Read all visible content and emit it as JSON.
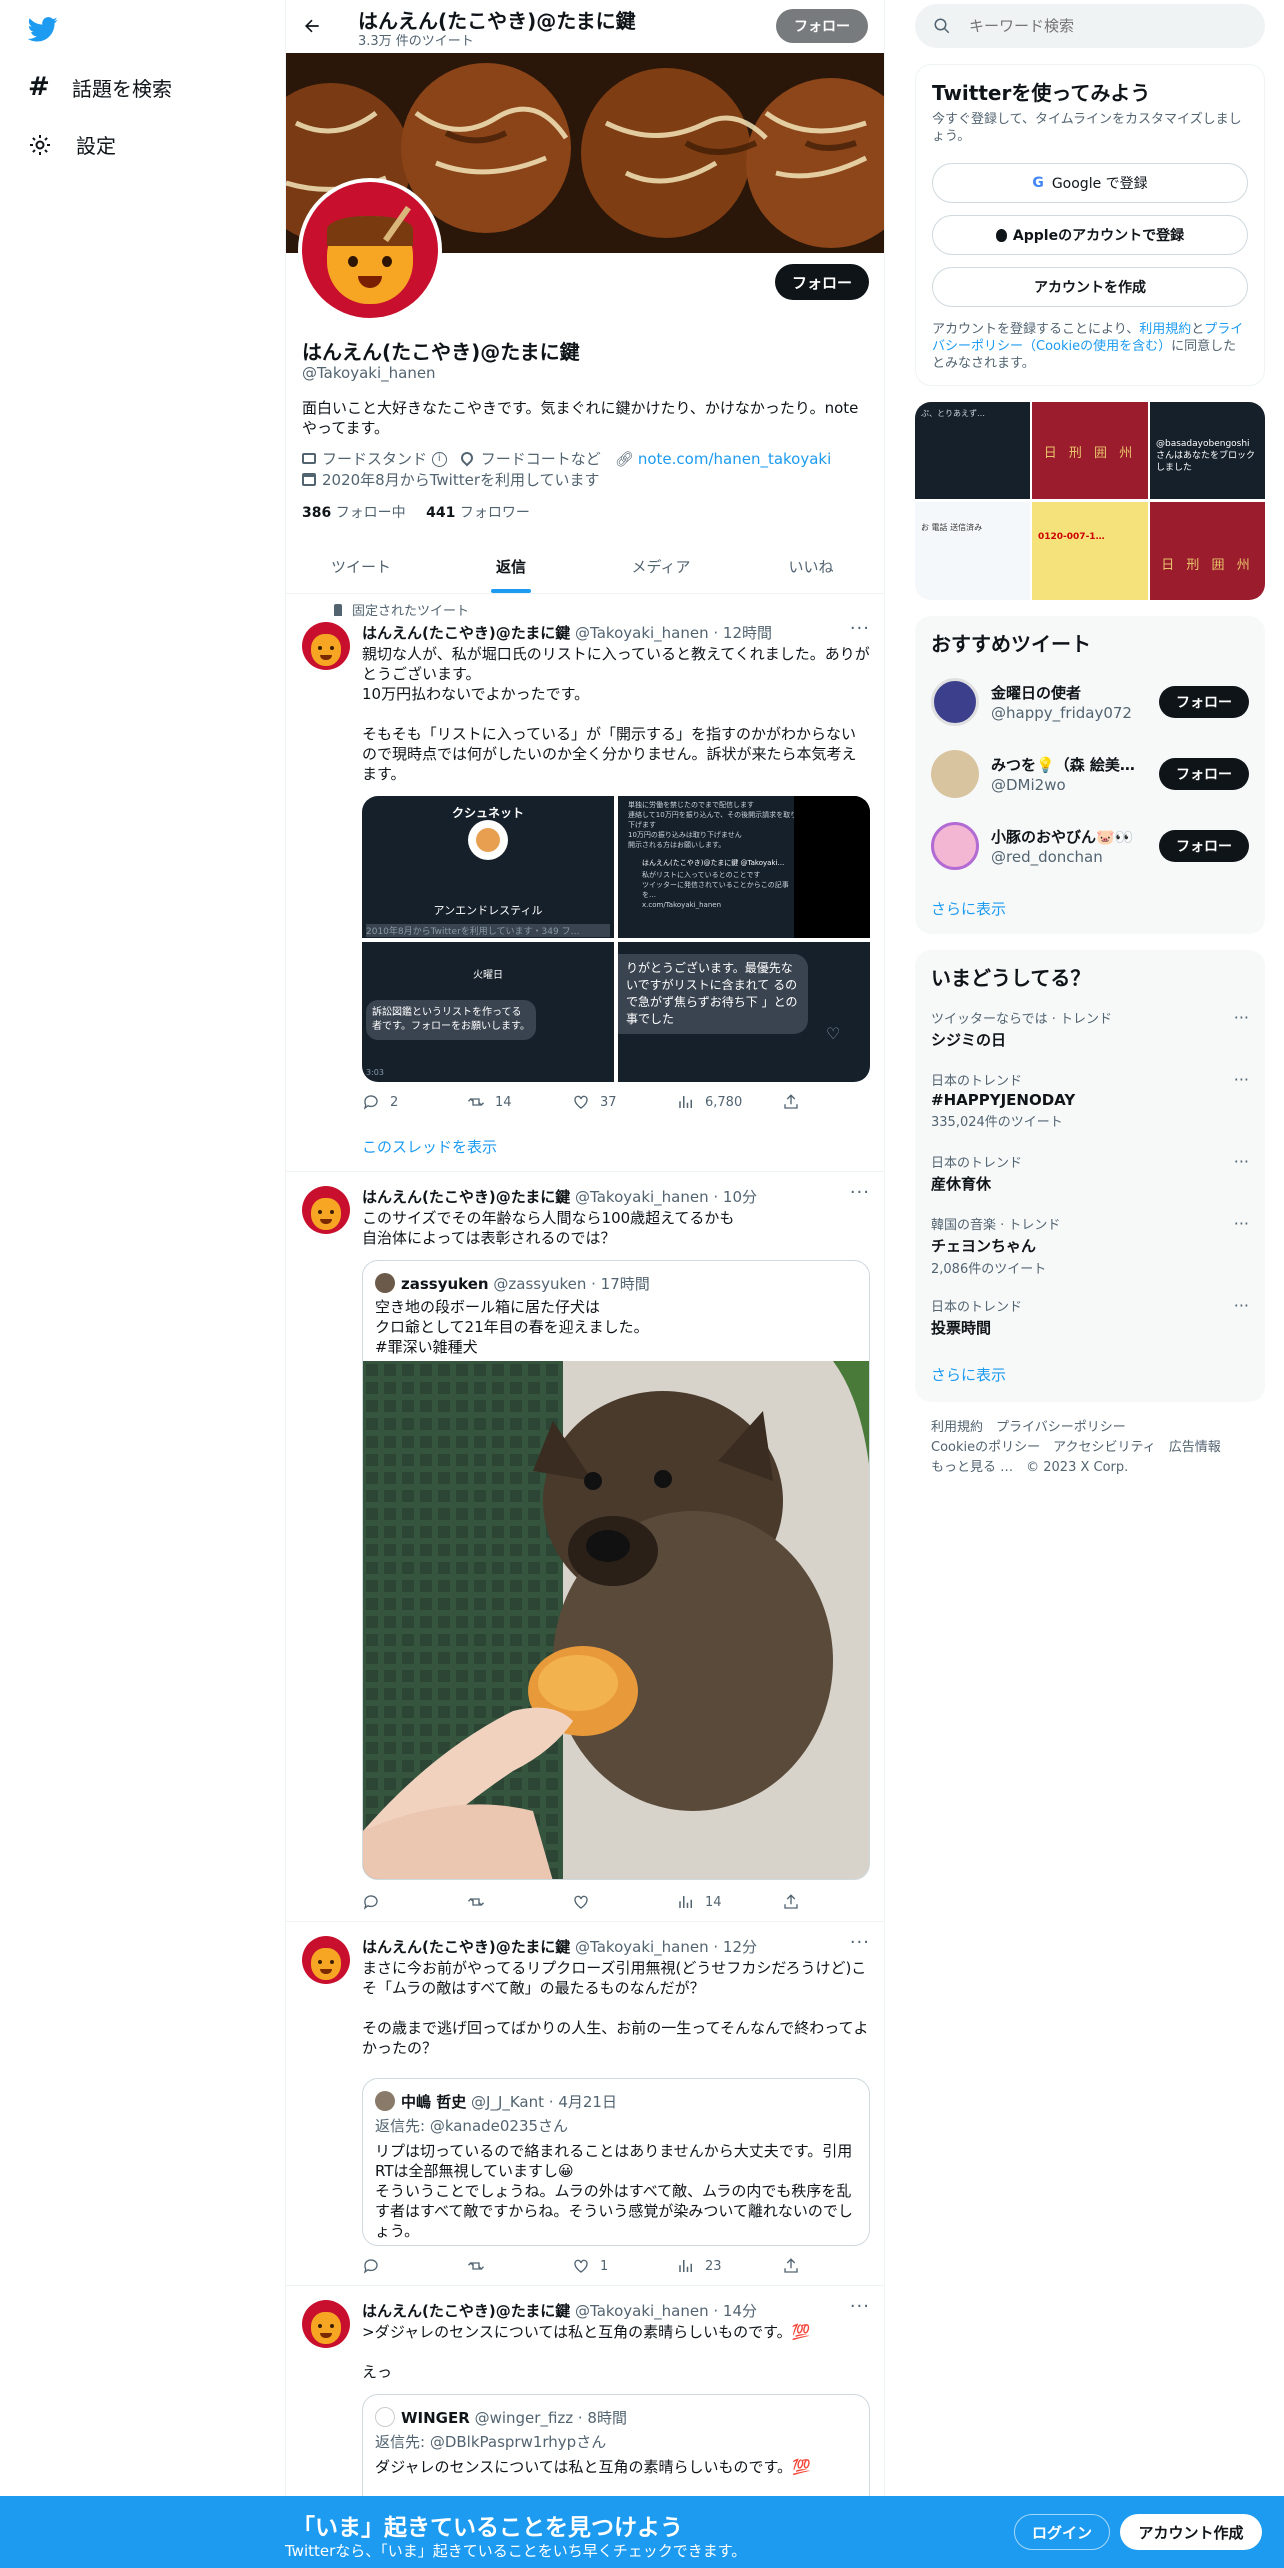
{
  "nav": {
    "explore": "話題を検索",
    "settings": "設定"
  },
  "header": {
    "title": "はんえん(たこやき)@たまに鍵",
    "subtitle": "3.3万 件のツイート",
    "follow": "フォロー"
  },
  "profile": {
    "name": "はんえん(たこやき)@たまに鍵",
    "handle": "@Takoyaki_hanen",
    "follow": "フォロー",
    "bio": "面白いこと大好きなたこやきです。気まぐれに鍵かけたり、かけなかったり。noteやってます。",
    "category": "フードスタンド",
    "location": "フードコートなど",
    "link": "note.com/hanen_takoyaki",
    "joined": "2020年8月からTwitterを利用しています",
    "following_count": "386",
    "following_label": "フォロー中",
    "followers_count": "441",
    "followers_label": "フォロワー"
  },
  "tabs": [
    "ツイート",
    "返信",
    "メディア",
    "いいね"
  ],
  "tweets": [
    {
      "pinned": "固定されたツイート",
      "name": "はんえん(たこやき)@たまに鍵",
      "meta": "@Takoyaki_hanen · 12時間",
      "text": "親切な人が、私が堀口氏のリストに入っていると教えてくれました。ありがとうございます。\n10万円払わないでよかったです。\n\nそもそも「リストに入っている」が「開示する」を指すのかがわからないので現時点では何がしたいのか全く分かりません。訴状が来たら本気考えます。",
      "img1_title": "クシュネット",
      "img1_name": "アンエンドレスティル",
      "img1_joined": "2010年8月からTwitterを利用しています・349 フ…",
      "img2_lines": "単独に労働を禁じたのでまで配信します\n連絡して10万円を振り込んで、その後開示請求を取り下げます\n10万円の振り込みは取り下げません\n開示される方はお願いします。",
      "img2_user": "はんえん(たこやき)@たまに鍵 @Takoyaki…",
      "img2_text": "私がリストに入っているとのことです\nツイッターに発信されていることからこの記事を…\nx.com/Takoyaki_hanen",
      "img3_day": "火曜日",
      "img3_bubble": "訴訟図鑑というリストを作ってる者です。フォローをお願いします。",
      "img3_time": "3:03",
      "img4_bubble": "りがとうございます。最優先ないですがリストに含まれて るので急がず焦らずお待ち下 」との事でした",
      "reply": "2",
      "retweet": "14",
      "like": "37",
      "views": "6,780",
      "thread": "このスレッドを表示"
    },
    {
      "name": "はんえん(たこやき)@たまに鍵",
      "meta": "@Takoyaki_hanen · 10分",
      "text": "このサイズでその年齢なら人間なら100歳超えてるかも\n自治体によっては表彰されるのでは？",
      "q_name": "zassyuken",
      "q_meta": "@zassyuken · 17時間",
      "q_text": "空き地の段ボール箱に居た仔犬は\nクロ爺として21年目の春を迎えました。\n#罪深い雑種犬",
      "reply": "",
      "retweet": "",
      "like": "",
      "views": "14"
    },
    {
      "name": "はんえん(たこやき)@たまに鍵",
      "meta": "@Takoyaki_hanen · 12分",
      "text": "まさに今お前がやってるリプクローズ引用無視(どうせフカシだろうけど)こそ「ムラの敵はすべて敵」の最たるものなんだが？\n\nその歳まで逃げ回ってばかりの人生、お前の一生ってそんなんで終わってよかったの？",
      "q_name": "中嶋 哲史",
      "q_meta": "@J_J_Kant · 4月21日",
      "q_reply": "返信先: @kanade0235さん",
      "q_text": "リプは切っているので絡まれることはありませんから大丈夫です。引用RTは全部無視していますし😀\nそういうことでしょうね。ムラの外はすべて敵、ムラの内でも秩序を乱す者はすべて敵ですからね。そういう感覚が染みついて離れないのでしょう。",
      "reply": "",
      "retweet": "",
      "like": "1",
      "views": "23"
    },
    {
      "name": "はんえん(たこやき)@たまに鍵",
      "meta": "@Takoyaki_hanen · 14分",
      "text": ">ダジャレのセンスについては私と互角の素晴らしいものです。💯\n\nえっ",
      "q_name": "WINGER",
      "q_meta": "@winger_fizz · 8時間",
      "q_reply": "返信先: @DBlkPasprw1rhypさん",
      "q_text": "ダジャレのセンスについては私と互角の素晴らしいものです。💯"
    }
  ],
  "search": {
    "placeholder": "キーワード検索"
  },
  "signup": {
    "title": "Twitterを使ってみよう",
    "subtitle": "今すぐ登録して、タイムラインをカスタマイズしましょう。",
    "google": "Google で登録",
    "apple": "Appleのアカウントで登録",
    "create": "アカウントを作成",
    "terms_a": "アカウントを登録することにより、",
    "terms_b": "利用規約",
    "terms_c": "と",
    "terms_d": "プライバシーポリシー（Cookieの使用を含む）",
    "terms_e": "に同意したとみなされます。"
  },
  "media_grid": {
    "t1": "ぷ、とりあえず…",
    "t2": "日 刑 囲 州",
    "t3": "@basadayobengoshi さんはあなたをブロックしました",
    "t4": "お 電話 送信済み",
    "t5": "0120-007-1…",
    "t6": "日 刑 囲 州"
  },
  "recommend": {
    "title": "おすすめツイート",
    "users": [
      {
        "name": "金曜日の使者",
        "handle": "@happy_friday072",
        "follow": "フォロー"
      },
      {
        "name": "みつを💡（森 絵美…",
        "handle": "@DMi2wo",
        "follow": "フォロー"
      },
      {
        "name": "小豚のおやびん🐷👀",
        "handle": "@red_donchan",
        "follow": "フォロー"
      }
    ],
    "more": "さらに表示"
  },
  "trends": {
    "title": "いまどうしてる？",
    "items": [
      {
        "meta": "ツイッターならでは · トレンド",
        "name": "シジミの日",
        "count": ""
      },
      {
        "meta": "日本のトレンド",
        "name": "#HAPPYJENODAY",
        "count": "335,024件のツイート"
      },
      {
        "meta": "日本のトレンド",
        "name": "産休育休",
        "count": ""
      },
      {
        "meta": "韓国の音楽 · トレンド",
        "name": "チェヨンちゃん",
        "count": "2,086件のツイート"
      },
      {
        "meta": "日本のトレンド",
        "name": "投票時間",
        "count": ""
      }
    ],
    "more": "さらに表示"
  },
  "footer": {
    "links1": "利用規約　プライバシーポリシー",
    "links2": "Cookieのポリシー　アクセシビリティ　広告情報",
    "links3": "もっと見る …　© 2023 X Corp."
  },
  "bottom": {
    "title": "「いま」起きていることを見つけよう",
    "subtitle": "Twitterなら、「いま」起きていることをいち早くチェックできます。",
    "login": "ログイン",
    "signup": "アカウント作成"
  },
  "colors": {
    "accent": "#1d9bf0",
    "text": "#0f1419",
    "secondary": "#536471"
  }
}
